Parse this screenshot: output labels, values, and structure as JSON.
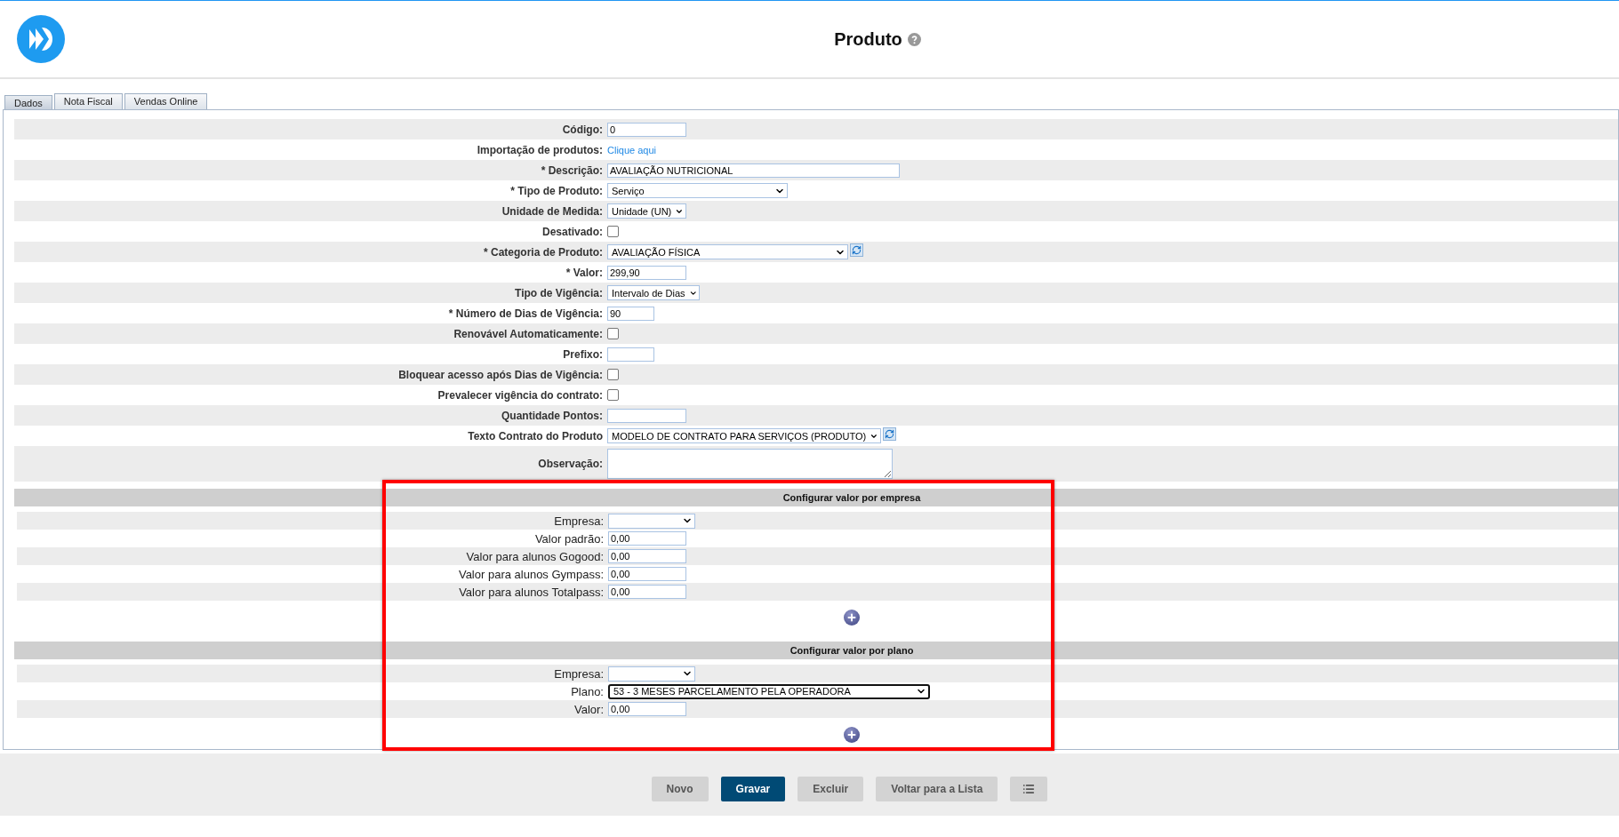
{
  "header": {
    "title": "Produto"
  },
  "tabs": [
    {
      "label": "Dados",
      "selected": true
    },
    {
      "label": "Nota Fiscal",
      "selected": false
    },
    {
      "label": "Vendas Online",
      "selected": false
    }
  ],
  "form": {
    "rows": [
      {
        "label": "Código:",
        "kind": "text",
        "value": "0"
      },
      {
        "label": "Importação de produtos:",
        "kind": "link",
        "value": "Clique aqui"
      },
      {
        "label": "* Descrição:",
        "kind": "text",
        "value": "AVALIAÇÃO NUTRICIONAL"
      },
      {
        "label": "* Tipo de Produto:",
        "kind": "select",
        "value": "Serviço"
      },
      {
        "label": "Unidade de Medida:",
        "kind": "select",
        "value": "Unidade (UN)"
      },
      {
        "label": "Desativado:",
        "kind": "checkbox",
        "checked": false
      },
      {
        "label": "* Categoria de Produto:",
        "kind": "select",
        "value": "AVALIAÇÃO FÍSICA",
        "refresh": true
      },
      {
        "label": "* Valor:",
        "kind": "text",
        "value": "299,90"
      },
      {
        "label": "Tipo de Vigência:",
        "kind": "select",
        "value": "Intervalo de Dias"
      },
      {
        "label": "* Número de Dias de Vigência:",
        "kind": "text",
        "value": "90"
      },
      {
        "label": "Renovável Automaticamente:",
        "kind": "checkbox",
        "checked": false
      },
      {
        "label": "Prefixo:",
        "kind": "text"
      },
      {
        "label": "Bloquear acesso após Dias de Vigência:",
        "kind": "checkbox",
        "checked": false
      },
      {
        "label": "Prevalecer vigência do contrato:",
        "kind": "checkbox",
        "checked": false
      },
      {
        "label": "Quantidade Pontos:",
        "kind": "text"
      },
      {
        "label": "Texto Contrato do Produto",
        "kind": "select",
        "value": "MODELO DE CONTRATO PARA SERVIÇOS (PRODUTO)",
        "refresh": true
      },
      {
        "label": "Observação:",
        "kind": "textarea"
      }
    ]
  },
  "sections": [
    {
      "title": "Configurar valor por empresa",
      "rows": [
        {
          "label": "Empresa:",
          "kind": "select",
          "focused": false
        },
        {
          "label": "Valor padrão:",
          "kind": "text",
          "value": "0,00",
          "focused": false
        },
        {
          "label": "Valor para alunos Gogood:",
          "kind": "text",
          "value": "0,00",
          "focused": false
        },
        {
          "label": "Valor para alunos Gympass:",
          "kind": "text",
          "value": "0,00",
          "focused": false
        },
        {
          "label": "Valor para alunos Totalpass:",
          "kind": "text",
          "value": "0,00",
          "focused": false
        }
      ]
    },
    {
      "title": "Configurar valor por plano",
      "rows": [
        {
          "label": "Empresa:",
          "kind": "select",
          "focused": false
        },
        {
          "label": "Plano:",
          "kind": "select",
          "value": "53 - 3 MESES PARCELAMENTO PELA OPERADORA",
          "focused": true
        },
        {
          "label": "Valor:",
          "kind": "text",
          "value": "0,00",
          "focused": false
        }
      ]
    }
  ],
  "highlight_sections": true,
  "footer": {
    "buttons": [
      {
        "label": "Novo",
        "kind": "secondary"
      },
      {
        "label": "Gravar",
        "kind": "primary"
      },
      {
        "label": "Excluir",
        "kind": "secondary"
      },
      {
        "label": "Voltar para a Lista",
        "kind": "secondary"
      },
      {
        "kind": "icon"
      }
    ]
  }
}
